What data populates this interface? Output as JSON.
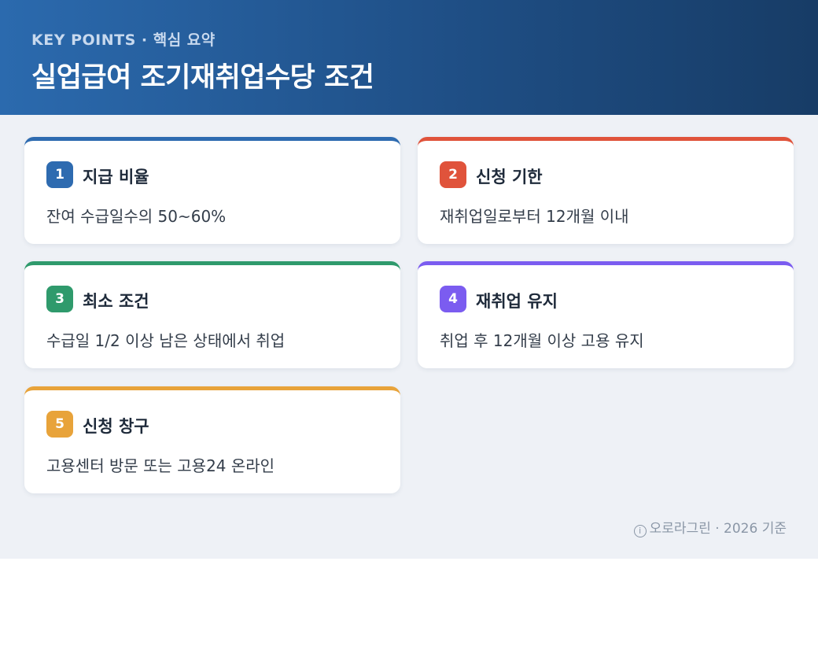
{
  "header": {
    "kicker": "KEY POINTS · 핵심 요약",
    "title": "실업급여 조기재취업수당 조건"
  },
  "cards": [
    {
      "number": "1",
      "heading": "지급 비율",
      "desc": "잔여 수급일수의 50~60%",
      "color": "#2e6bb0"
    },
    {
      "number": "2",
      "heading": "신청 기한",
      "desc": "재취업일로부터 12개월 이내",
      "color": "#e0533b"
    },
    {
      "number": "3",
      "heading": "최소 조건",
      "desc": "수급일 1/2 이상 남은 상태에서 취업",
      "color": "#2f9a6c"
    },
    {
      "number": "4",
      "heading": "재취업 유지",
      "desc": "취업 후 12개월 이상 고용 유지",
      "color": "#7b5cf0"
    },
    {
      "number": "5",
      "heading": "신청 창구",
      "desc": "고용센터 방문 또는 고용24 온라인",
      "color": "#e8a33a"
    }
  ],
  "footer": {
    "icon": "info-icon",
    "text": "오로라그린 · 2026 기준"
  }
}
